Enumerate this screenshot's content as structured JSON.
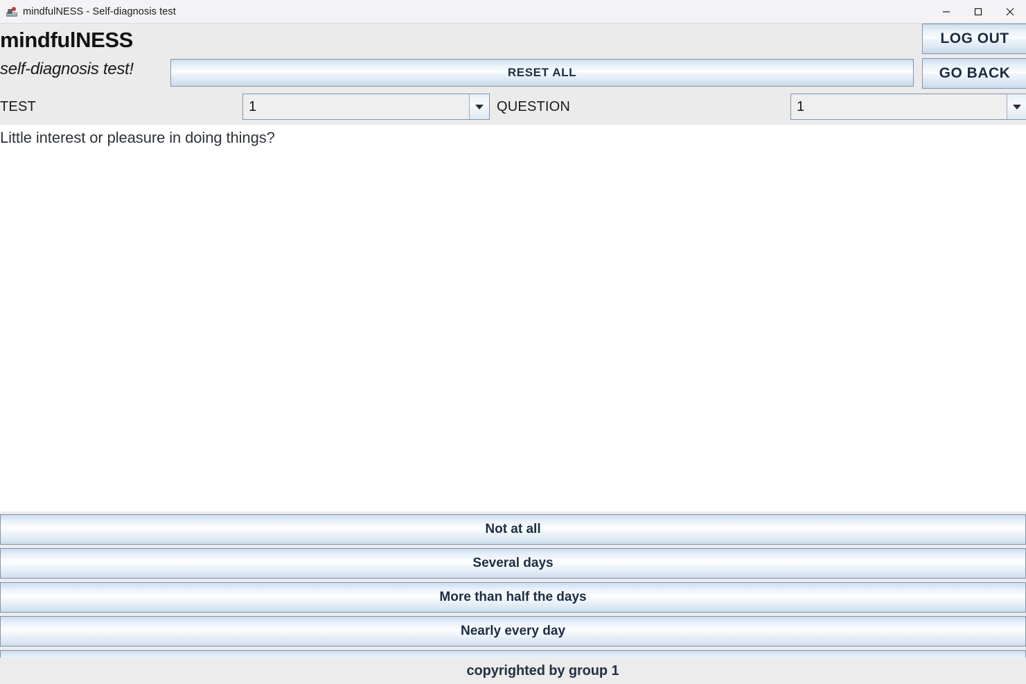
{
  "window": {
    "title": "mindfulNESS - Self-diagnosis test",
    "icon": "app-icon",
    "controls": {
      "minimize": "minimize-icon",
      "maximize": "maximize-icon",
      "close": "close-icon"
    }
  },
  "header": {
    "brand_title": "mindfulNESS",
    "brand_subtitle": "self-diagnosis test!",
    "reset_all_label": "RESET ALL",
    "log_out_label": "LOG OUT",
    "go_back_label": "GO BACK"
  },
  "selectors": {
    "test": {
      "label": "TEST",
      "value": "1",
      "arrow_icon": "chevron-down-icon"
    },
    "question": {
      "label": "QUESTION",
      "value": "1",
      "arrow_icon": "chevron-down-icon"
    }
  },
  "content": {
    "question_text": "Little interest or pleasure in doing things?"
  },
  "answers": [
    {
      "label": "Not at all"
    },
    {
      "label": "Several days"
    },
    {
      "label": "More than half the days"
    },
    {
      "label": "Nearly every day"
    },
    {
      "label": ""
    }
  ],
  "footer": {
    "text": "copyrighted by group 1"
  },
  "colors": {
    "header_bg": "#ebebeb",
    "content_bg": "#ffffff",
    "button_border": "#7e94ad",
    "button_text": "#1b2c43",
    "titlebar_bg": "#f3f3f5"
  }
}
